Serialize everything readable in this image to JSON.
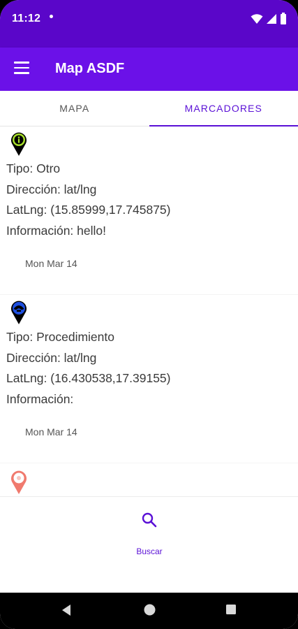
{
  "status_bar": {
    "time": "11:12"
  },
  "app_bar": {
    "title": "Map ASDF"
  },
  "tabs": [
    {
      "label": "MAPA",
      "active": false
    },
    {
      "label": "MARCADORES",
      "active": true
    }
  ],
  "markers": [
    {
      "icon": "info-pin-icon",
      "pin_color": "#a8e02a",
      "lines": [
        "Tipo: Otro",
        "Dirección: lat/lng",
        "LatLng: (15.85999,17.745875)",
        "Información: hello!"
      ],
      "date": "Mon Mar 14"
    },
    {
      "icon": "procedure-pin-icon",
      "pin_color": "#1e4fe0",
      "lines": [
        "Tipo: Procedimiento",
        "Dirección: lat/lng",
        "LatLng: (16.430538,17.39155)",
        "Información:"
      ],
      "date": "Mon Mar 14"
    },
    {
      "icon": "location-pin-icon",
      "pin_color": "#f07a6e"
    }
  ],
  "bottom_nav": {
    "search_label": "Buscar"
  },
  "colors": {
    "status_bar": "#5a06c9",
    "app_bar": "#6b11e8",
    "accent": "#5a10d6"
  }
}
